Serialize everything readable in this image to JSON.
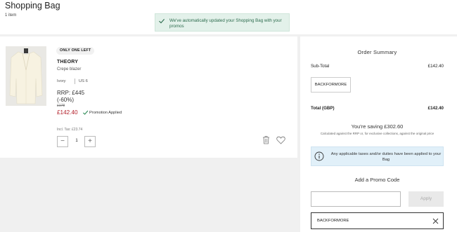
{
  "header": {
    "title": "Shopping Bag",
    "item_count": "1 item"
  },
  "notification": {
    "message": "We've automatically updated your Shopping Bag with your promos",
    "icon": "check-icon"
  },
  "item": {
    "tag": "ONLY ONE LEFT",
    "brand": "THEORY",
    "name": "Crepe blazer",
    "color": "Ivory",
    "size": "US 6",
    "rrp": "RRP: £445",
    "discount": "(-60%)",
    "original_price": "£178",
    "sale_price": "£142.40",
    "promo_status": "Promotion Applied",
    "tax_note": "Incl. Tax: £23.74",
    "quantity": "1",
    "qty_minus": "−",
    "qty_plus": "+"
  },
  "summary": {
    "title": "Order Summary",
    "subtotal_label": "Sub-Total",
    "subtotal_value": "£142.40",
    "applied_code_chip": "BACKFORMORE",
    "total_label": "Total (GBP)",
    "total_value": "£142.40",
    "saving_text": "You're saving £302.60",
    "saving_note": "Calculated against the RRP or, for exclusive collections, against the original price",
    "info_text": "Any applicable taxes and/or duties have been applied to your Bag",
    "promo_title": "Add a Promo Code",
    "promo_placeholder": "",
    "apply_label": "Apply",
    "applied_code": "BACKFORMORE"
  },
  "colors": {
    "sale_red": "#b3202a",
    "success_green": "#2c6b4d",
    "toast_bg": "#e3f1ea",
    "info_bg": "#e1f0f9"
  }
}
